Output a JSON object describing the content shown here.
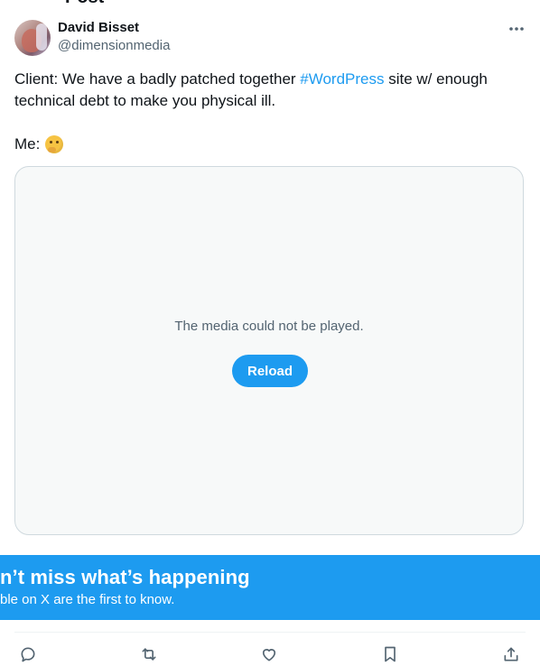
{
  "page": {
    "partial_title": "Post"
  },
  "tweet": {
    "author_name": "David Bisset",
    "author_handle": "@dimensionmedia",
    "text_part1": "Client: We have a badly patched together ",
    "hashtag": "#WordPress",
    "text_part2": " site w/ enough technical debt to make you physical ill.",
    "line2": "Me:",
    "emoji": "thinking-face-emoji"
  },
  "media": {
    "error_message": "The media could not be played.",
    "reload_label": "Reload"
  },
  "banner": {
    "title": "n’t miss what’s happening",
    "subtitle": "ble on X are the first to know."
  },
  "actions": {
    "icons": [
      "reply-icon",
      "repost-icon",
      "like-icon",
      "bookmark-icon",
      "share-icon"
    ]
  },
  "colors": {
    "accent": "#1d9bf0",
    "text_primary": "#0f1419",
    "text_secondary": "#536471",
    "media_bg": "#f7f9f9",
    "border": "#cfd9de"
  }
}
